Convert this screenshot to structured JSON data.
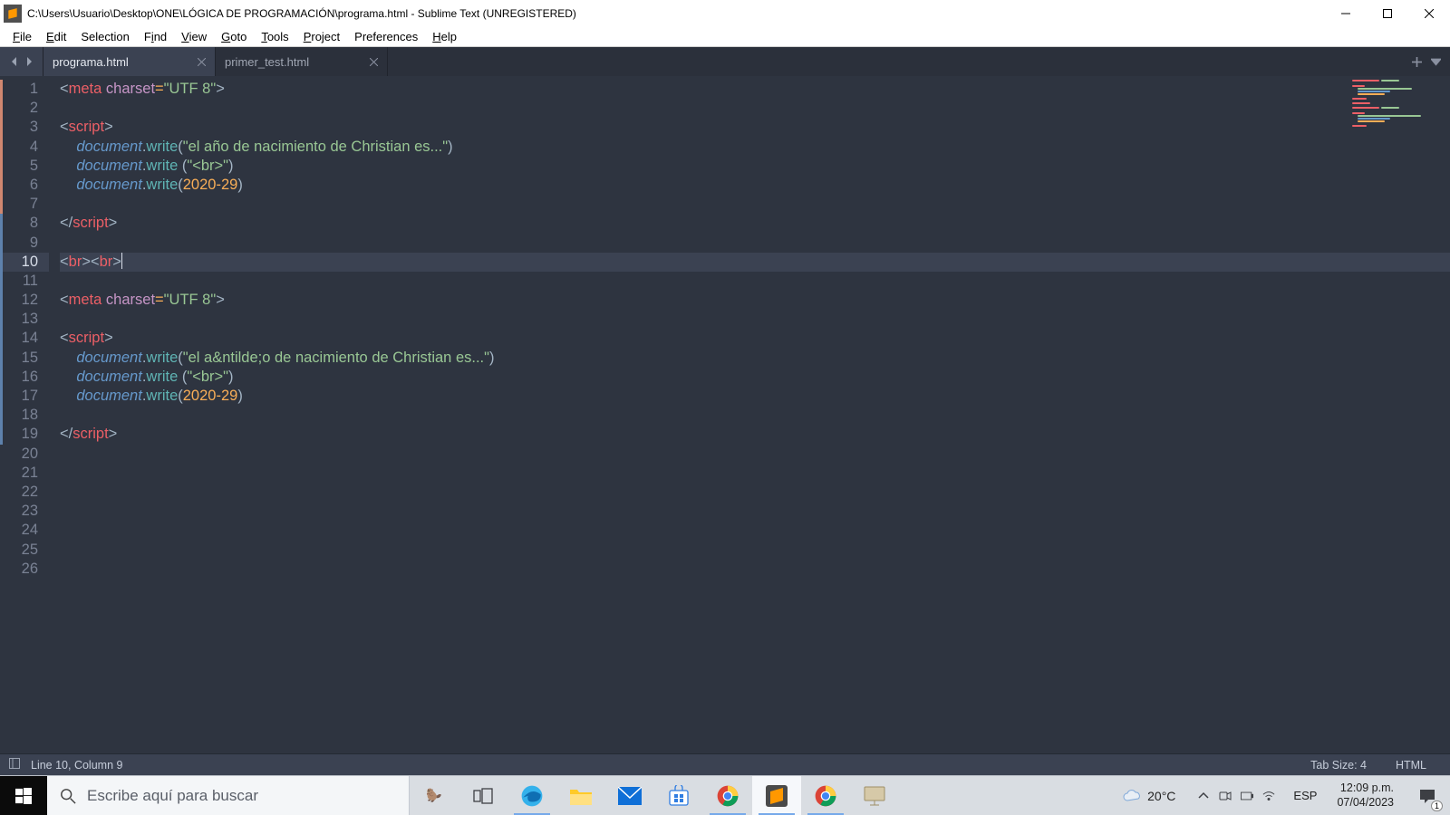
{
  "window": {
    "title": "C:\\Users\\Usuario\\Desktop\\ONE\\LÓGICA DE PROGRAMACIÓN\\programa.html - Sublime Text (UNREGISTERED)"
  },
  "menu": {
    "file": "File",
    "edit": "Edit",
    "selection": "Selection",
    "find": "Find",
    "view": "View",
    "goto": "Goto",
    "tools": "Tools",
    "project": "Project",
    "preferences": "Preferences",
    "help": "Help"
  },
  "tabs": [
    {
      "label": "programa.html",
      "active": true
    },
    {
      "label": "primer_test.html",
      "active": false
    }
  ],
  "code_lines": [
    [
      {
        "t": "<",
        "c": "pun"
      },
      {
        "t": "meta",
        "c": "tag"
      },
      {
        "t": " ",
        "c": ""
      },
      {
        "t": "charset",
        "c": "attr"
      },
      {
        "t": "=",
        "c": "op"
      },
      {
        "t": "\"UTF 8\"",
        "c": "str"
      },
      {
        "t": ">",
        "c": "pun"
      }
    ],
    [],
    [
      {
        "t": "<",
        "c": "pun"
      },
      {
        "t": "script",
        "c": "tag"
      },
      {
        "t": ">",
        "c": "pun"
      }
    ],
    [
      {
        "t": "    ",
        "c": ""
      },
      {
        "t": "document",
        "c": "obj"
      },
      {
        "t": ".",
        "c": "pun"
      },
      {
        "t": "write",
        "c": "fn"
      },
      {
        "t": "(",
        "c": "pun"
      },
      {
        "t": "\"el año de nacimiento de Christian es...\"",
        "c": "str"
      },
      {
        "t": ")",
        "c": "pun"
      }
    ],
    [
      {
        "t": "    ",
        "c": ""
      },
      {
        "t": "document",
        "c": "obj"
      },
      {
        "t": ".",
        "c": "pun"
      },
      {
        "t": "write",
        "c": "fn"
      },
      {
        "t": " (",
        "c": "pun"
      },
      {
        "t": "\"<br>\"",
        "c": "str"
      },
      {
        "t": ")",
        "c": "pun"
      }
    ],
    [
      {
        "t": "    ",
        "c": ""
      },
      {
        "t": "document",
        "c": "obj"
      },
      {
        "t": ".",
        "c": "pun"
      },
      {
        "t": "write",
        "c": "fn"
      },
      {
        "t": "(",
        "c": "pun"
      },
      {
        "t": "2020",
        "c": "num"
      },
      {
        "t": "-",
        "c": "op"
      },
      {
        "t": "29",
        "c": "num"
      },
      {
        "t": ")",
        "c": "pun"
      }
    ],
    [],
    [
      {
        "t": "</",
        "c": "pun"
      },
      {
        "t": "script",
        "c": "tag"
      },
      {
        "t": ">",
        "c": "pun"
      }
    ],
    [],
    [
      {
        "t": "<",
        "c": "pun"
      },
      {
        "t": "br",
        "c": "tag"
      },
      {
        "t": "><",
        "c": "pun"
      },
      {
        "t": "br",
        "c": "tag"
      },
      {
        "t": ">",
        "c": "pun"
      }
    ],
    [],
    [
      {
        "t": "<",
        "c": "pun"
      },
      {
        "t": "meta",
        "c": "tag"
      },
      {
        "t": " ",
        "c": ""
      },
      {
        "t": "charset",
        "c": "attr"
      },
      {
        "t": "=",
        "c": "op"
      },
      {
        "t": "\"UTF 8\"",
        "c": "str"
      },
      {
        "t": ">",
        "c": "pun"
      }
    ],
    [],
    [
      {
        "t": "<",
        "c": "pun"
      },
      {
        "t": "script",
        "c": "tag"
      },
      {
        "t": ">",
        "c": "pun"
      }
    ],
    [
      {
        "t": "    ",
        "c": ""
      },
      {
        "t": "document",
        "c": "obj"
      },
      {
        "t": ".",
        "c": "pun"
      },
      {
        "t": "write",
        "c": "fn"
      },
      {
        "t": "(",
        "c": "pun"
      },
      {
        "t": "\"el a&ntilde;o de nacimiento de Christian es...\"",
        "c": "str"
      },
      {
        "t": ")",
        "c": "pun"
      }
    ],
    [
      {
        "t": "    ",
        "c": ""
      },
      {
        "t": "document",
        "c": "obj"
      },
      {
        "t": ".",
        "c": "pun"
      },
      {
        "t": "write",
        "c": "fn"
      },
      {
        "t": " (",
        "c": "pun"
      },
      {
        "t": "\"<br>\"",
        "c": "str"
      },
      {
        "t": ")",
        "c": "pun"
      }
    ],
    [
      {
        "t": "    ",
        "c": ""
      },
      {
        "t": "document",
        "c": "obj"
      },
      {
        "t": ".",
        "c": "pun"
      },
      {
        "t": "write",
        "c": "fn"
      },
      {
        "t": "(",
        "c": "pun"
      },
      {
        "t": "2020",
        "c": "num"
      },
      {
        "t": "-",
        "c": "op"
      },
      {
        "t": "29",
        "c": "num"
      },
      {
        "t": ")",
        "c": "pun"
      }
    ],
    [],
    [
      {
        "t": "</",
        "c": "pun"
      },
      {
        "t": "script",
        "c": "tag"
      },
      {
        "t": ">",
        "c": "pun"
      }
    ],
    [],
    [],
    [],
    [],
    [],
    [],
    []
  ],
  "gutter_mods": {
    "1": "orange",
    "2": "orange",
    "3": "orange",
    "4": "orange",
    "5": "orange",
    "6": "orange",
    "7": "orange",
    "8": "teal",
    "9": "teal",
    "10": "teal",
    "11": "teal",
    "12": "teal",
    "13": "teal",
    "14": "teal",
    "15": "teal",
    "16": "teal",
    "17": "teal",
    "18": "teal",
    "19": "teal"
  },
  "current_line": 10,
  "status": {
    "position": "Line 10, Column 9",
    "tab_size": "Tab Size: 4",
    "syntax": "HTML"
  },
  "taskbar": {
    "search_placeholder": "Escribe aquí para buscar",
    "weather_temp": "20°C",
    "lang": "ESP",
    "time": "12:09 p.m.",
    "date": "07/04/2023",
    "notif_count": "1"
  }
}
